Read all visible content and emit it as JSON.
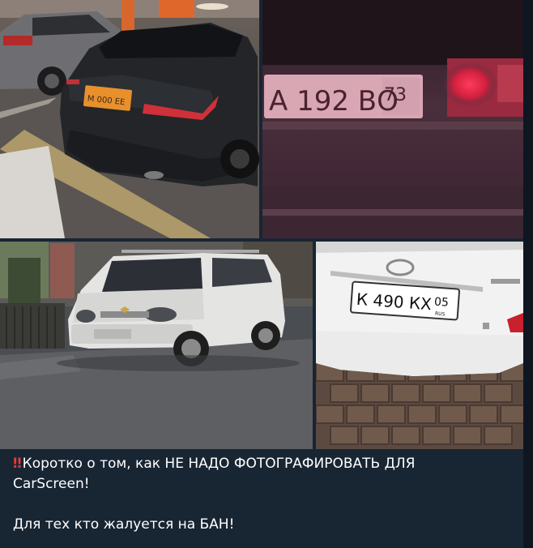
{
  "photos": [
    {
      "id": "photo-1",
      "plate": "М 000 ЕЕ"
    },
    {
      "id": "photo-2",
      "plate_main": "А 192 ВО",
      "plate_region": "73"
    },
    {
      "id": "photo-3"
    },
    {
      "id": "photo-4",
      "plate_main": "К 490 КХ",
      "plate_region": "05",
      "plate_country": "RUS"
    }
  ],
  "message": {
    "alert_icon": "‼",
    "line1": "Коротко о том, как НЕ НАДО ФОТОГРАФИРОВАТЬ ДЛЯ",
    "line2": "CarScreen!",
    "line3": "Для тех кто жалуется на БАН!"
  },
  "colors": {
    "chat_bg": "#0e1621",
    "bubble_bg": "#182533",
    "text": "#ffffff",
    "alert": "#e53935"
  }
}
